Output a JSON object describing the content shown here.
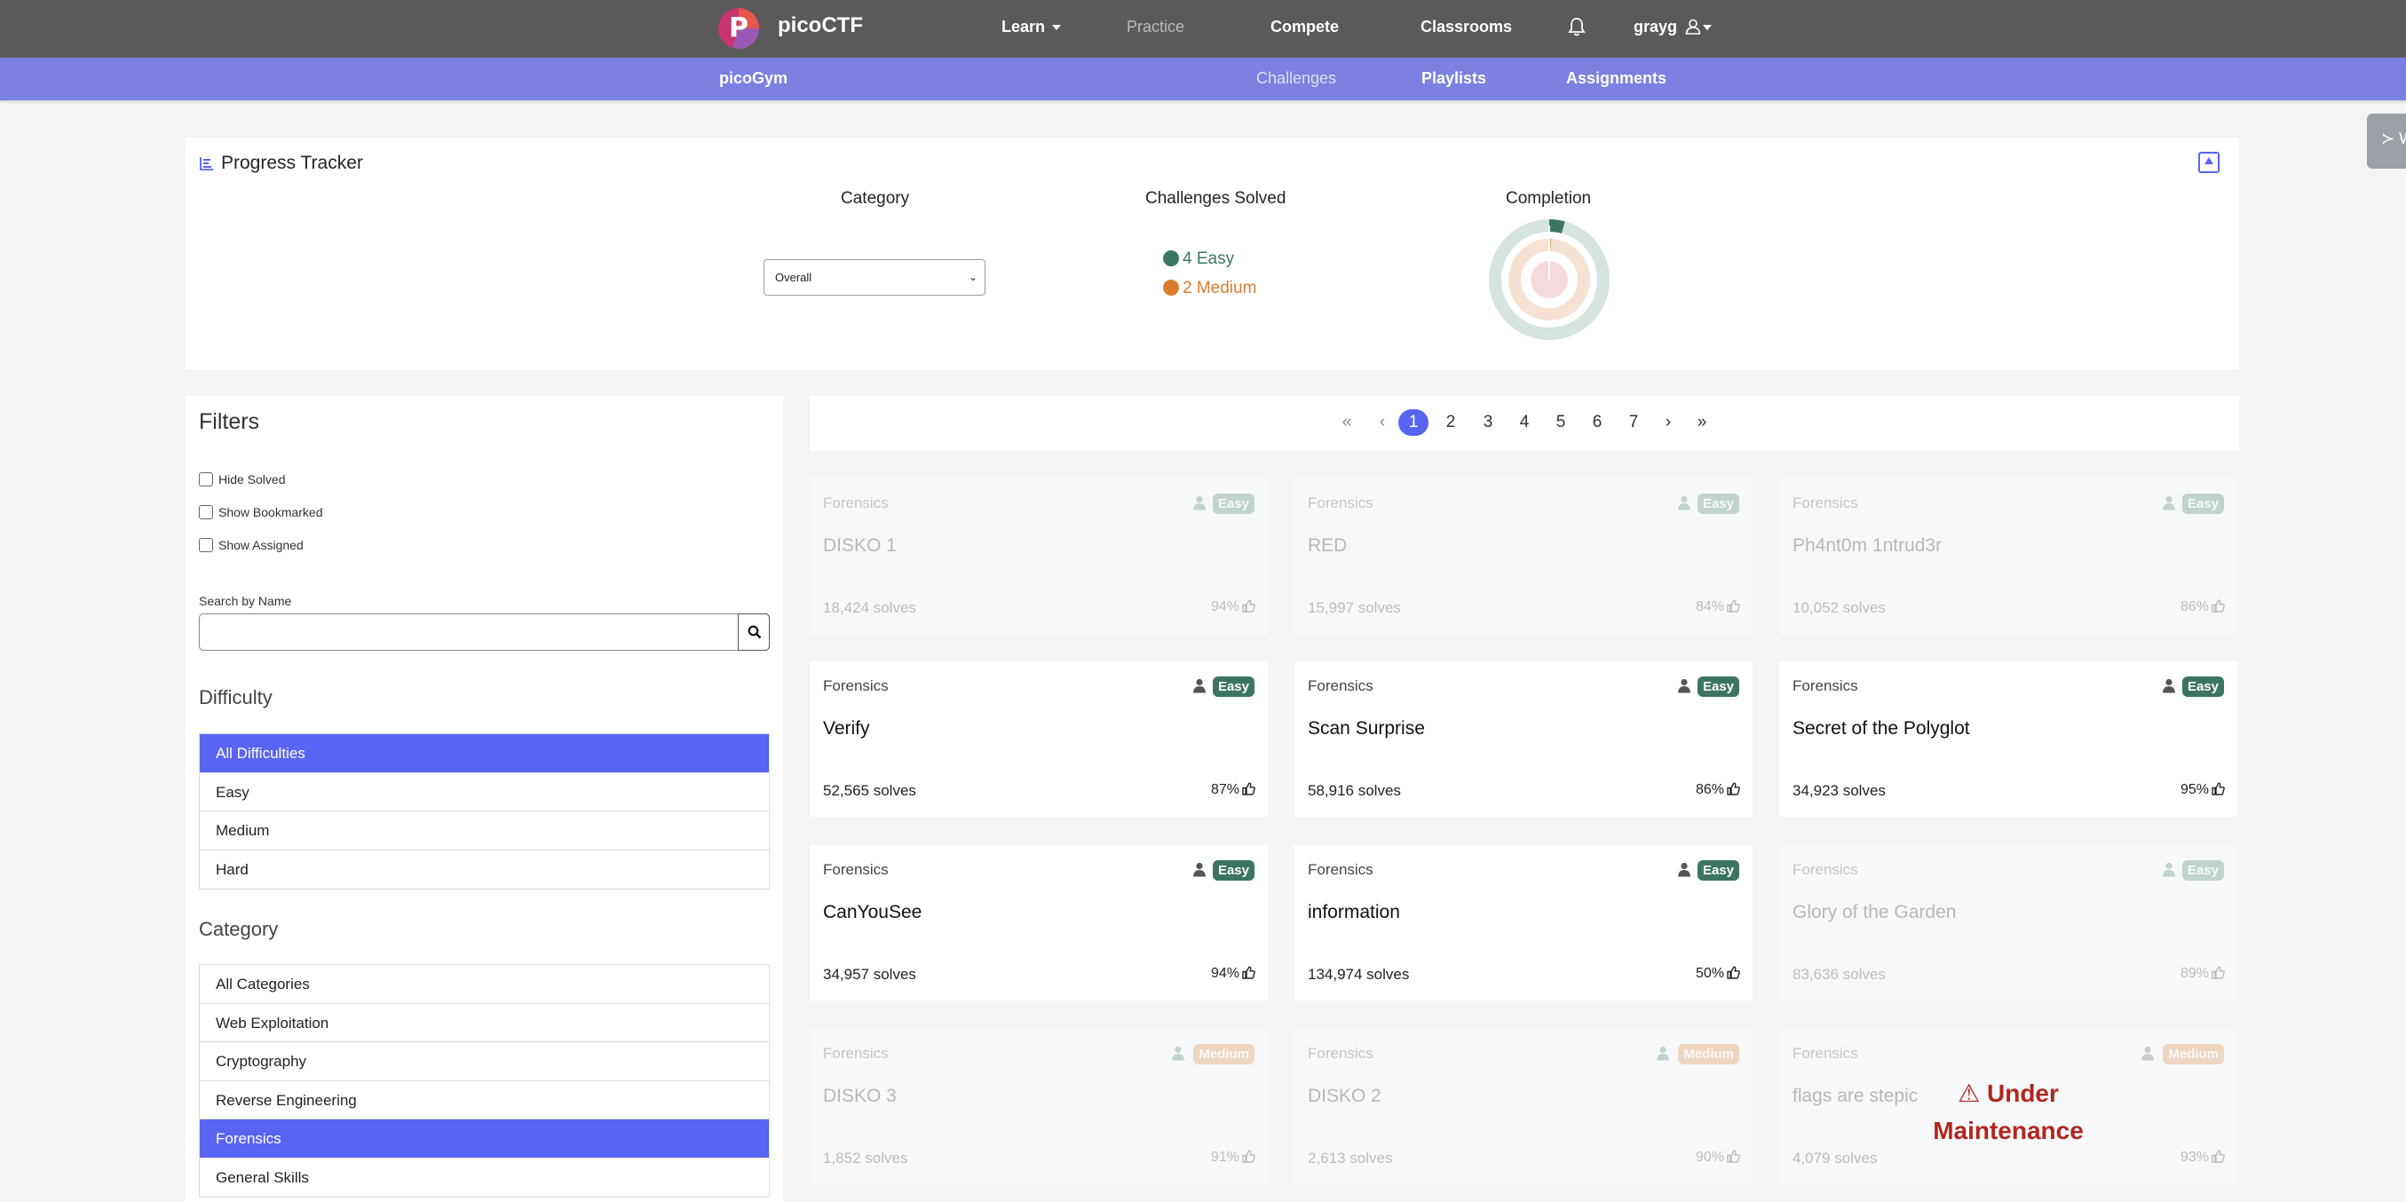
{
  "topnav": {
    "brand": "picoCTF",
    "logo_letter": "P",
    "learn": "Learn",
    "practice": "Practice",
    "compete": "Compete",
    "classrooms": "Classrooms",
    "user": "grayg",
    "bell_icon": "bell-icon",
    "user_icon": "user-icon"
  },
  "subnav": {
    "brand": "picoGym",
    "challenges": "Challenges",
    "playlists": "Playlists",
    "assignments": "Assignments"
  },
  "progress": {
    "title": "Progress Tracker",
    "category_header": "Category",
    "solved_header": "Challenges Solved",
    "completion_header": "Completion",
    "category_value": "Overall",
    "easy_label": "4 Easy",
    "medium_label": "2 Medium",
    "colors": {
      "easy": "#3b7561",
      "medium": "#d97d2d"
    }
  },
  "filters": {
    "title": "Filters",
    "hide_solved": "Hide Solved",
    "show_bookmarked": "Show Bookmarked",
    "show_assigned": "Show Assigned",
    "search_label": "Search by Name",
    "search_value": "",
    "difficulty_title": "Difficulty",
    "difficulties": [
      "All Difficulties",
      "Easy",
      "Medium",
      "Hard"
    ],
    "category_title": "Category",
    "categories": [
      "All Categories",
      "Web Exploitation",
      "Cryptography",
      "Reverse Engineering",
      "Forensics",
      "General Skills"
    ]
  },
  "pagination": {
    "first": "«",
    "prev": "‹",
    "next": "›",
    "last": "»",
    "pages": [
      "1",
      "2",
      "3",
      "4",
      "5",
      "6",
      "7"
    ],
    "current": "1"
  },
  "cards": [
    {
      "category": "Forensics",
      "name": "DISKO 1",
      "solves": "18,424 solves",
      "rate": "94%",
      "difficulty": "Easy",
      "solved": true
    },
    {
      "category": "Forensics",
      "name": "RED",
      "solves": "15,997 solves",
      "rate": "84%",
      "difficulty": "Easy",
      "solved": true
    },
    {
      "category": "Forensics",
      "name": "Ph4nt0m 1ntrud3r",
      "solves": "10,052 solves",
      "rate": "86%",
      "difficulty": "Easy",
      "solved": true
    },
    {
      "category": "Forensics",
      "name": "Verify",
      "solves": "52,565 solves",
      "rate": "87%",
      "difficulty": "Easy",
      "solved": false
    },
    {
      "category": "Forensics",
      "name": "Scan Surprise",
      "solves": "58,916 solves",
      "rate": "86%",
      "difficulty": "Easy",
      "solved": false
    },
    {
      "category": "Forensics",
      "name": "Secret of the Polyglot",
      "solves": "34,923 solves",
      "rate": "95%",
      "difficulty": "Easy",
      "solved": false
    },
    {
      "category": "Forensics",
      "name": "CanYouSee",
      "solves": "34,957 solves",
      "rate": "94%",
      "difficulty": "Easy",
      "solved": false
    },
    {
      "category": "Forensics",
      "name": "information",
      "solves": "134,974 solves",
      "rate": "50%",
      "difficulty": "Easy",
      "solved": false
    },
    {
      "category": "Forensics",
      "name": "Glory of the Garden",
      "solves": "83,636 solves",
      "rate": "89%",
      "difficulty": "Easy",
      "solved": true
    },
    {
      "category": "Forensics",
      "name": "DISKO 3",
      "solves": "1,852 solves",
      "rate": "91%",
      "difficulty": "Medium",
      "solved": true
    },
    {
      "category": "Forensics",
      "name": "DISKO 2",
      "solves": "2,613 solves",
      "rate": "90%",
      "difficulty": "Medium",
      "solved": true
    },
    {
      "category": "Forensics",
      "name": "flags are stepic",
      "solves": "4,079 solves",
      "rate": "93%",
      "difficulty": "Medium",
      "solved": false,
      "maintenance": "⚠ Under Maintenance"
    }
  ],
  "sidetab": {
    "icon": "terminal-icon",
    "text": "≻ W"
  }
}
